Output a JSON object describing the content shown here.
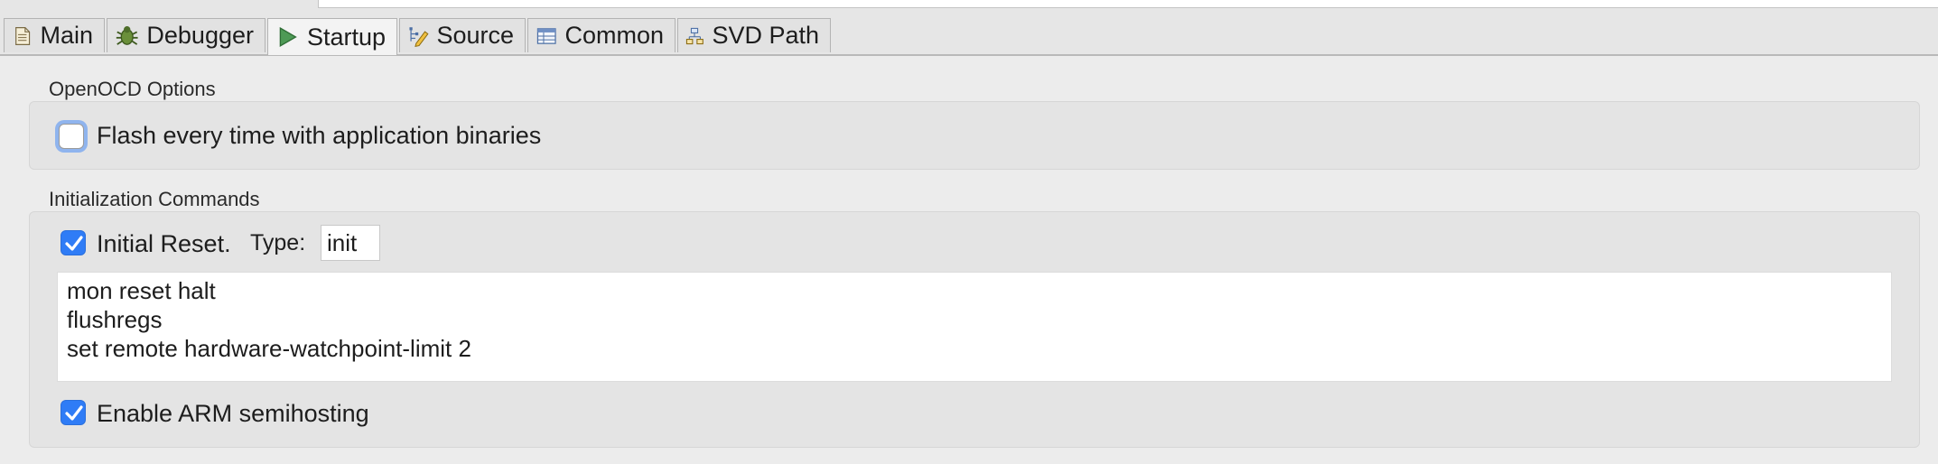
{
  "tabs": [
    {
      "label": "Main",
      "icon": "document-icon"
    },
    {
      "label": "Debugger",
      "icon": "bug-icon"
    },
    {
      "label": "Startup",
      "icon": "play-icon",
      "active": true
    },
    {
      "label": "Source",
      "icon": "source-edit-icon"
    },
    {
      "label": "Common",
      "icon": "table-icon"
    },
    {
      "label": "SVD Path",
      "icon": "tree-icon"
    }
  ],
  "openocd": {
    "title": "OpenOCD Options",
    "flash_label": "Flash every time with application binaries",
    "flash_checked": false
  },
  "init": {
    "title": "Initialization Commands",
    "reset_label": "Initial Reset.",
    "reset_checked": true,
    "type_label": "Type:",
    "type_value": "init",
    "commands": [
      "mon reset halt",
      "flushregs",
      "set remote hardware-watchpoint-limit 2"
    ],
    "semihosting_label": "Enable ARM semihosting",
    "semihosting_checked": true
  },
  "colors": {
    "accent": "#2f7cf6",
    "focus_ring": "#8fb4ee"
  }
}
